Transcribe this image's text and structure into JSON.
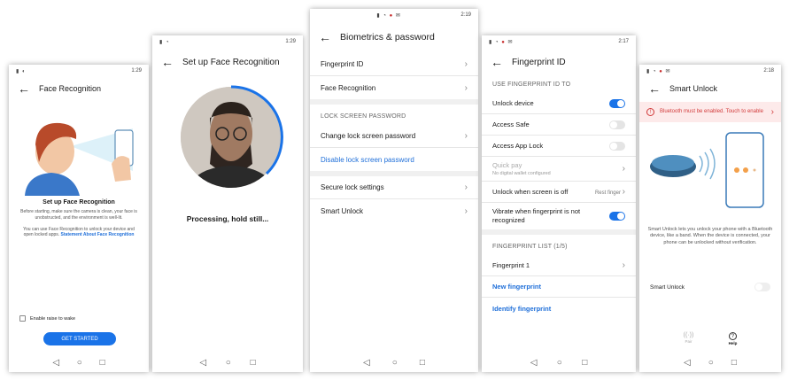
{
  "p1": {
    "time": "1:29",
    "title": "Face Recognition",
    "heading": "Set up Face Recognition",
    "desc": "Before starting, make sure the camera is clean, your face is unobstructed, and the environment is well-lit.",
    "desc2": "You can use Face Recognition to unlock your device and open locked apps.",
    "link": "Statement About Face Recognition",
    "checkbox_label": "Enable raise to wake",
    "button": "GET STARTED"
  },
  "p2": {
    "time": "1:29",
    "title": "Set up Face Recognition",
    "status": "Processing, hold still..."
  },
  "p3": {
    "time": "2:19",
    "title": "Biometrics & password",
    "items": [
      "Fingerprint ID",
      "Face Recognition"
    ],
    "section": "LOCK SCREEN PASSWORD",
    "change": "Change lock screen password",
    "disable": "Disable lock screen password",
    "items2": [
      "Secure lock settings",
      "Smart Unlock"
    ]
  },
  "p4": {
    "time": "2:17",
    "title": "Fingerprint ID",
    "section1": "USE FINGERPRINT ID TO",
    "unlock": "Unlock device",
    "safe": "Access Safe",
    "applock": "Access App Lock",
    "quickpay": "Quick pay",
    "quickpay_sub": "No digital wallet configured",
    "screenoff": "Unlock when screen is off",
    "screenoff_val": "Rest finger",
    "vibrate": "Vibrate when fingerprint is not recognized",
    "section2": "FINGERPRINT LIST (1/5)",
    "fp1": "Fingerprint 1",
    "new": "New fingerprint",
    "identify": "Identify fingerprint"
  },
  "p5": {
    "time": "2:18",
    "title": "Smart Unlock",
    "warning": "Bluetooth must be enabled. Touch to enable",
    "desc": "Smart Unlock lets you unlock your phone with a Bluetooth device, like a band. When the device is connected, your phone can be unlocked without verification.",
    "toggle_label": "Smart Unlock",
    "tab1": "Pair",
    "tab2": "Help"
  },
  "colors": {
    "accent": "#1a73e8",
    "warning_bg": "#fdeaea",
    "warning_text": "#d23b3b"
  }
}
